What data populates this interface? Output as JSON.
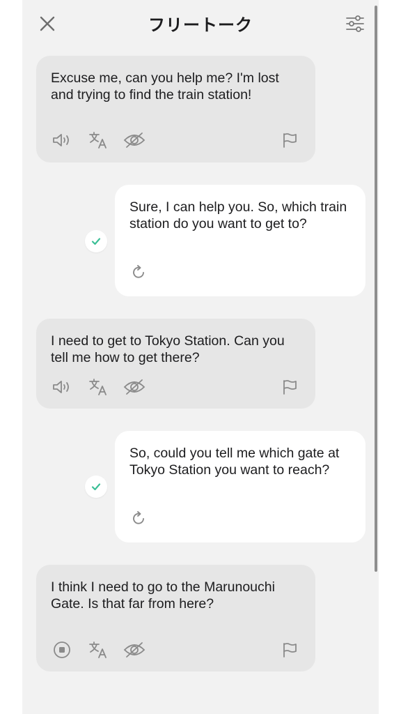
{
  "header": {
    "title": "フリートーク",
    "close_icon": "close-icon",
    "settings_icon": "sliders-icon"
  },
  "colors": {
    "background": "#f2f2f2",
    "ai_bubble": "#e6e6e6",
    "user_bubble": "#ffffff",
    "check_accent": "#3bbf96",
    "icon": "#8a8a8a"
  },
  "messages": [
    {
      "role": "ai",
      "text": "Excuse me, can you help me? I'm lost and trying to find the train station!",
      "actions": [
        "speaker-icon",
        "translate-icon",
        "eye-off-icon",
        "flag-icon"
      ]
    },
    {
      "role": "user",
      "text": "Sure, I can help you. So, which train station do you want to get to?",
      "status": "check-icon",
      "action": "retry-icon"
    },
    {
      "role": "ai",
      "text": "I need to get to Tokyo Station. Can you tell me how to get there?",
      "actions": [
        "speaker-icon",
        "translate-icon",
        "eye-off-icon",
        "flag-icon"
      ]
    },
    {
      "role": "user",
      "text": "So, could you tell me which gate at Tokyo Station you want to reach?",
      "status": "check-icon",
      "action": "retry-icon"
    },
    {
      "role": "ai",
      "text": "I think I need to go to the Marunouchi Gate. Is that far from here?",
      "actions": [
        "stop-icon",
        "translate-icon",
        "eye-off-icon",
        "flag-icon"
      ]
    }
  ]
}
